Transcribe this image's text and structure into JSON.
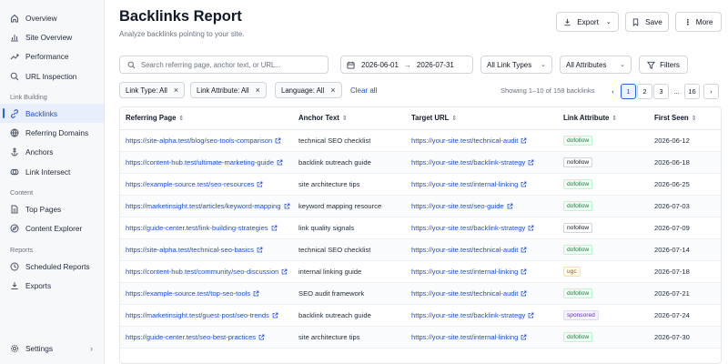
{
  "sidebar": {
    "items_top": [
      {
        "label": "Overview",
        "icon": "home-icon"
      },
      {
        "label": "Site Overview",
        "icon": "bar-chart-icon"
      },
      {
        "label": "Performance",
        "icon": "trend-icon"
      },
      {
        "label": "URL Inspection",
        "icon": "search-icon"
      }
    ],
    "section_link": "Link Building",
    "items_link": [
      {
        "label": "Backlinks",
        "icon": "link-icon"
      },
      {
        "label": "Referring Domains",
        "icon": "globe-icon"
      },
      {
        "label": "Anchors",
        "icon": "anchor-icon"
      },
      {
        "label": "Link Intersect",
        "icon": "intersect-icon"
      }
    ],
    "section_content": "Content",
    "items_content": [
      {
        "label": "Top Pages",
        "icon": "page-icon"
      },
      {
        "label": "Content Explorer",
        "icon": "explore-icon"
      }
    ],
    "section_reports": "Reports",
    "items_reports": [
      {
        "label": "Scheduled Reports",
        "icon": "clock-icon"
      },
      {
        "label": "Exports",
        "icon": "download-icon"
      }
    ],
    "settings": "Settings"
  },
  "header": {
    "title": "Backlinks Report",
    "subtitle": "Analyze backlinks pointing to your site.",
    "export": "Export",
    "save": "Save",
    "more": "More"
  },
  "filters": {
    "search_placeholder": "Search referring page, anchor text, or URL...",
    "date_from": "2026-06-01",
    "date_arrow": "→",
    "date_to": "2026-07-31",
    "link_types": "All Link Types",
    "attributes": "All Attributes",
    "filters_btn": "Filters"
  },
  "chips": {
    "link_type": "Link Type: All",
    "link_attribute": "Link Attribute: All",
    "language": "Language: All",
    "clear_all": "Clear all"
  },
  "pagination": {
    "showing": "Showing 1–10 of 158 backlinks",
    "prev": "‹",
    "p1": "1",
    "p2": "2",
    "p3": "3",
    "ellipsis": "...",
    "last": "16",
    "next": "›"
  },
  "table": {
    "columns": [
      "Referring Page",
      "Anchor Text",
      "Target URL",
      "Link Attribute",
      "First Seen"
    ],
    "rows": [
      {
        "ref": "https://site-alpha.test/blog/seo-tools-comparison",
        "anchor": "technical SEO checklist",
        "target": "https://your-site.test/technical-audit",
        "attr": "dofollow",
        "date": "2026-06-12"
      },
      {
        "ref": "https://content-hub.test/ultimate-marketing-guide",
        "anchor": "backlink outreach guide",
        "target": "https://your-site.test/backlink-strategy",
        "attr": "nofollow",
        "date": "2026-06-18"
      },
      {
        "ref": "https://example-source.test/seo-resources",
        "anchor": "site architecture tips",
        "target": "https://your-site.test/internal-linking",
        "attr": "dofollow",
        "date": "2026-06-25"
      },
      {
        "ref": "https://marketinsight.test/articles/keyword-mapping",
        "anchor": "keyword mapping resource",
        "target": "https://your-site.test/seo-guide",
        "attr": "dofollow",
        "date": "2026-07-03"
      },
      {
        "ref": "https://guide-center.test/link-building-strategies",
        "anchor": "link quality signals",
        "target": "https://your-site.test/backlink-strategy",
        "attr": "nofollow",
        "date": "2026-07-09"
      },
      {
        "ref": "https://site-alpha.test/technical-seo-basics",
        "anchor": "technical SEO checklist",
        "target": "https://your-site.test/technical-audit",
        "attr": "dofollow",
        "date": "2026-07-14"
      },
      {
        "ref": "https://content-hub.test/community/seo-discussion",
        "anchor": "internal linking guide",
        "target": "https://your-site.test/internal-linking",
        "attr": "ugc",
        "date": "2026-07-18"
      },
      {
        "ref": "https://example-source.test/top-seo-tools",
        "anchor": "SEO audit framework",
        "target": "https://your-site.test/technical-audit",
        "attr": "dofollow",
        "date": "2026-07-21"
      },
      {
        "ref": "https://marketinsight.test/guest-post/seo-trends",
        "anchor": "backlink outreach guide",
        "target": "https://your-site.test/backlink-strategy",
        "attr": "sponsored",
        "date": "2026-07-24"
      },
      {
        "ref": "https://guide-center.test/seo-best-practices",
        "anchor": "site architecture tips",
        "target": "https://your-site.test/internal-linking",
        "attr": "dofollow",
        "date": "2026-07-30"
      }
    ]
  }
}
